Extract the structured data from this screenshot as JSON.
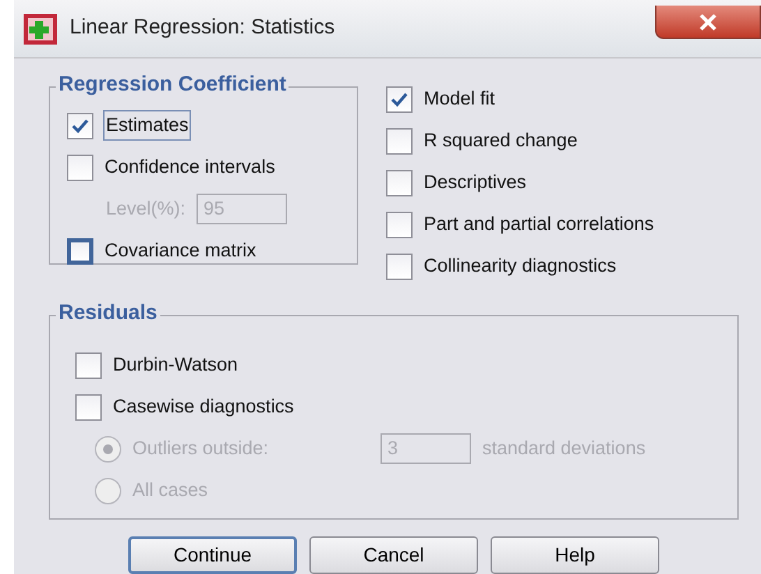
{
  "window": {
    "title": "Linear Regression: Statistics"
  },
  "regression_coefficients": {
    "title": "Regression Coefficient",
    "options": [
      {
        "kind": "checkbox",
        "label": "Estimates",
        "checked": true,
        "focused": true,
        "hovered": false
      },
      {
        "kind": "checkbox",
        "label": "Confidence intervals",
        "checked": false,
        "focused": false,
        "hovered": false
      },
      {
        "kind": "field",
        "label": "Level(%):",
        "value": "95",
        "disabled": true
      },
      {
        "kind": "checkbox",
        "label": "Covariance matrix",
        "checked": false,
        "focused": false,
        "hovered": true
      }
    ]
  },
  "statistics": [
    {
      "label": "Model fit",
      "checked": true
    },
    {
      "label": "R squared change",
      "checked": false
    },
    {
      "label": "Descriptives",
      "checked": false
    },
    {
      "label": "Part and partial correlations",
      "checked": false
    },
    {
      "label": "Collinearity diagnostics",
      "checked": false
    }
  ],
  "residuals": {
    "title": "Residuals",
    "options": [
      {
        "kind": "checkbox",
        "label": "Durbin-Watson",
        "checked": false,
        "disabled": false
      },
      {
        "kind": "checkbox",
        "label": "Casewise diagnostics",
        "checked": false,
        "disabled": false
      },
      {
        "kind": "radio",
        "label": "Outliers outside:",
        "selected": true,
        "disabled": true,
        "value": "3",
        "suffix": "standard deviations"
      },
      {
        "kind": "radio",
        "label": "All cases",
        "selected": false,
        "disabled": true
      }
    ]
  },
  "buttons": [
    {
      "label": "Continue",
      "default": true
    },
    {
      "label": "Cancel",
      "default": false
    },
    {
      "label": "Help",
      "default": false
    }
  ]
}
